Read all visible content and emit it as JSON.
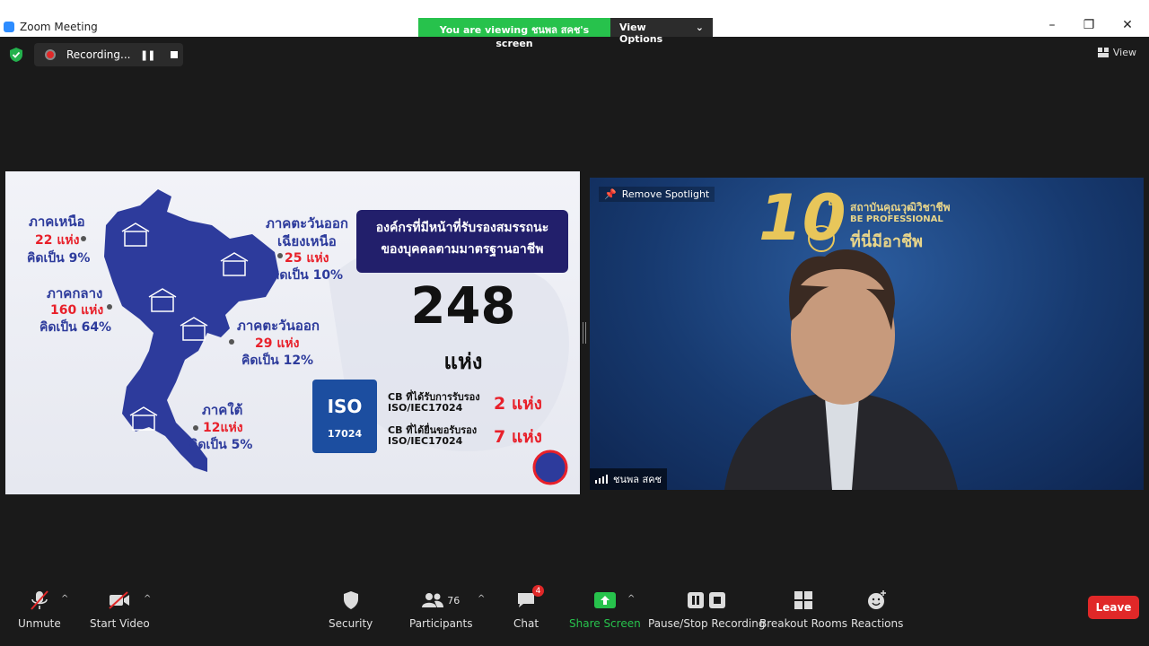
{
  "window": {
    "title": "Zoom Meeting",
    "controls": [
      "–",
      "❐",
      "✕"
    ]
  },
  "share_banner": {
    "viewing_text": "You are viewing ชนพล สคช's screen",
    "view_options": "View Options"
  },
  "recording": {
    "status": "Recording..."
  },
  "view_button": "View",
  "slide": {
    "regions": [
      {
        "name": "ภาคเหนือ",
        "count": "22 แห่ง",
        "percent": "คิดเป็น 9%"
      },
      {
        "name_line1": "ภาคตะวันออก",
        "name_line2": "เฉียงเหนือ",
        "count": "25 แห่ง",
        "percent": "คิดเป็น 10%"
      },
      {
        "name": "ภาคกลาง",
        "count": "160 แห่ง",
        "percent": "คิดเป็น 64%"
      },
      {
        "name": "ภาคตะวันออก",
        "count": "29 แห่ง",
        "percent": "คิดเป็น 12%"
      },
      {
        "name": "ภาคใต้",
        "count": "12แห่ง",
        "percent": "คิดเป็น 5%"
      }
    ],
    "heading_line1": "องค์กรที่มีหน้าที่รับรองสมรรถนะ",
    "heading_line2": "ของบุคคลตามมาตรฐานอาชีพ",
    "total_number": "248",
    "total_unit": "แห่ง",
    "iso_logo_text": "ISO",
    "iso_number": "17024",
    "cb_items": [
      {
        "line1": "CB ที่ได้รับการรับรอง",
        "line2": "ISO/IEC17024",
        "count": "2 แห่ง"
      },
      {
        "line1": "CB ที่ได้ยื่นขอรับรอง",
        "line2": "ISO/IEC17024",
        "count": "7 แห่ง"
      }
    ]
  },
  "video": {
    "remove_spotlight": "Remove Spotlight",
    "participant_name": "ชนพล สคช",
    "banner_10": "10",
    "banner_th": "th",
    "banner_line1": "สถาบันคุณวุฒิวิชาชีพ",
    "banner_line2": "BE PROFESSIONAL",
    "banner_line3": "ที่นี่มีอาชีพ"
  },
  "toolbar": {
    "unmute": "Unmute",
    "start_video": "Start Video",
    "security": "Security",
    "participants": "Participants",
    "participants_count": "76",
    "chat": "Chat",
    "chat_badge": "4",
    "share_screen": "Share Screen",
    "pause_stop": "Pause/Stop Recording",
    "breakout": "Breakout Rooms",
    "reactions": "Reactions",
    "leave": "Leave"
  },
  "colors": {
    "share_green": "#27c24c",
    "leave_red": "#e02828",
    "map_blue": "#2d3b9c",
    "slide_red": "#e8202a"
  }
}
